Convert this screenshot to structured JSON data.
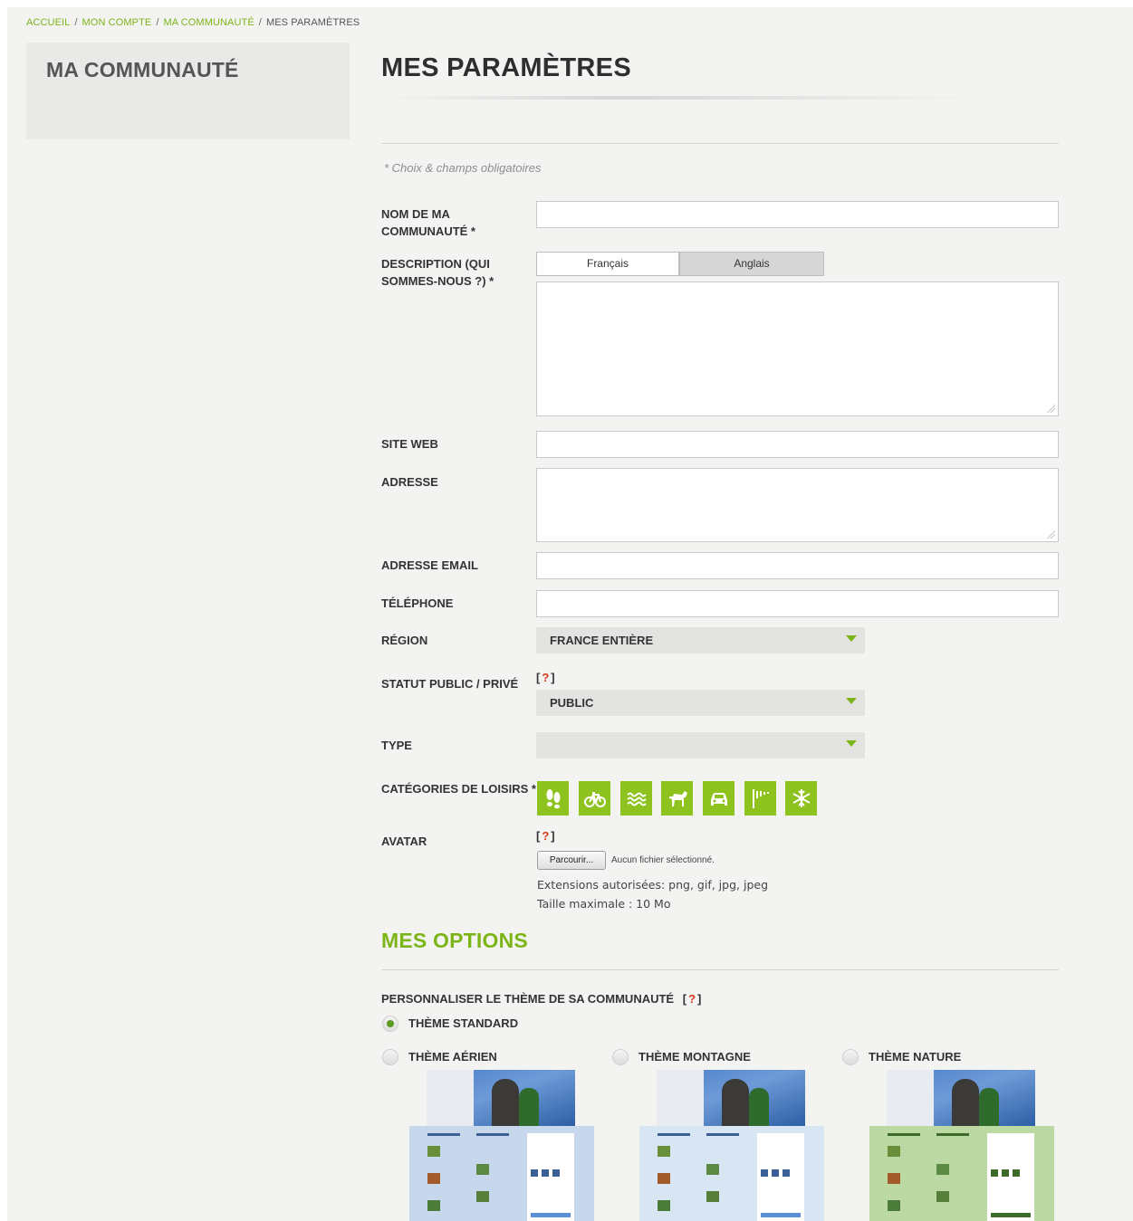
{
  "breadcrumb": {
    "home": "ACCUEIL",
    "account": "MON COMPTE",
    "community": "MA COMMUNAUTÉ",
    "current": "MES PARAMÈTRES",
    "separator": "/"
  },
  "sidebar": {
    "title": "MA COMMUNAUTÉ"
  },
  "page_title": "MES PARAMÈTRES",
  "required_note": "* Choix & champs obligatoires",
  "form": {
    "community_name": {
      "label_line1": "NOM DE MA",
      "label_line2": "COMMUNAUTÉ *",
      "value": ""
    },
    "description": {
      "label_line1": "DESCRIPTION (QUI",
      "label_line2": "SOMMES-NOUS ?) *",
      "tab_french": "Français",
      "tab_english": "Anglais",
      "value": ""
    },
    "website": {
      "label": "SITE WEB",
      "value": ""
    },
    "address": {
      "label": "ADRESSE",
      "value": ""
    },
    "email": {
      "label": "ADRESSE EMAIL",
      "value": ""
    },
    "phone": {
      "label": "TÉLÉPHONE",
      "value": ""
    },
    "region": {
      "label": "RÉGION",
      "value": "FRANCE ENTIÈRE"
    },
    "status": {
      "label": "STATUT PUBLIC / PRIVÉ",
      "value": "PUBLIC"
    },
    "type": {
      "label": "TYPE",
      "value": ""
    },
    "categories": {
      "label": "CATÉGORIES DE LOISIRS *",
      "icons": [
        "footprints-icon",
        "bicycle-icon",
        "water-waves-icon",
        "horse-icon",
        "car-icon",
        "trail-marker-icon",
        "snowflake-icon"
      ],
      "color": "#8dc21f"
    },
    "avatar": {
      "label": "AVATAR",
      "browse_button": "Parcourir...",
      "no_file": "Aucun fichier sélectionné.",
      "extensions": "Extensions autorisées: png, gif, jpg, jpeg",
      "max_size": "Taille maximale : 10 Mo"
    },
    "help_open": "[",
    "help_mark": "?",
    "help_close": "]"
  },
  "options": {
    "title": "MES OPTIONS",
    "theme_label": "PERSONNALISER LE THÈME DE SA COMMUNAUTÉ",
    "themes": {
      "standard": {
        "label": "THÈME STANDARD",
        "selected": true
      },
      "aerial": {
        "label": "THÈME AÉRIEN",
        "selected": false
      },
      "mountain": {
        "label": "THÈME MONTAGNE",
        "selected": false
      },
      "nature": {
        "label": "THÈME NATURE",
        "selected": false
      }
    }
  },
  "colors": {
    "accent": "#7cb518",
    "help_red": "#d83b1c",
    "aerial_bg": "#c7d7ec",
    "mountain_bg": "#d8e6f3",
    "nature_bg": "#bcd9a4"
  }
}
